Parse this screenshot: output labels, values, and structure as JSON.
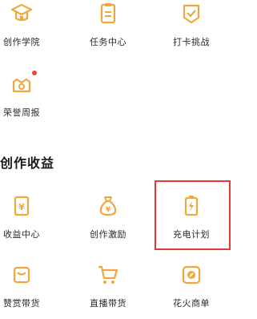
{
  "colors": {
    "accent": "#f2a73b",
    "highlight": "#e53935",
    "badge": "#ff3b30"
  },
  "row1": [
    {
      "label": "创作学院",
      "icon": "graduation-cap-icon"
    },
    {
      "label": "任务中心",
      "icon": "clipboard-icon"
    },
    {
      "label": "打卡挑战",
      "icon": "check-badge-icon"
    }
  ],
  "row2": [
    {
      "label": "荣誉周报",
      "icon": "trophy-icon"
    }
  ],
  "section": {
    "title": "创作收益"
  },
  "row3": [
    {
      "label": "收益中心",
      "icon": "yuan-card-icon"
    },
    {
      "label": "创作激励",
      "icon": "money-bag-icon"
    },
    {
      "label": "充电计划",
      "icon": "battery-charge-icon"
    }
  ],
  "row4": [
    {
      "label": "赞赏带货",
      "icon": "shopping-bag-icon"
    },
    {
      "label": "直播带货",
      "icon": "cart-icon"
    },
    {
      "label": "花火商单",
      "icon": "spark-order-icon"
    }
  ]
}
